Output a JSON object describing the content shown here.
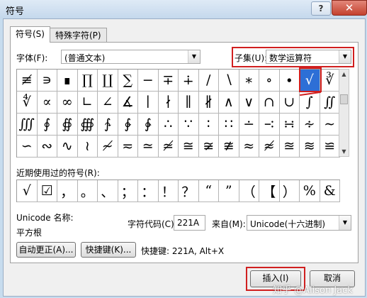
{
  "window": {
    "title": "符号",
    "help": "?",
    "close": "✕"
  },
  "tabs": [
    "符号(S)",
    "特殊字符(P)"
  ],
  "font": {
    "label": "字体(F):",
    "value": "(普通文本)"
  },
  "subset": {
    "label": "子集(U):",
    "value": "数学运算符"
  },
  "symbols": [
    "≢",
    "∍",
    "∎",
    "∏",
    "∐",
    "∑",
    "−",
    "∓",
    "∔",
    "∕",
    "∖",
    "∗",
    "∘",
    "∙",
    "√",
    "∛",
    "∜",
    "∝",
    "∞",
    "∟",
    "∠",
    "∡",
    "∣",
    "∤",
    "∥",
    "∦",
    "∧",
    "∨",
    "∩",
    "∪",
    "∫",
    "∬",
    "∭",
    "∮",
    "∯",
    "∰",
    "∱",
    "∲",
    "∳",
    "∴",
    "∵",
    "∶",
    "∷",
    "∸",
    "∹",
    "∺",
    "∻",
    "∼",
    "∽",
    "∾",
    "∿",
    "≀",
    "≁",
    "≂",
    "≃",
    "≄",
    "≅",
    "≆",
    "≇",
    "≈",
    "≉",
    "≊",
    "≋",
    "≌"
  ],
  "selected_index": 14,
  "recent": {
    "label": "近期使用过的符号(R):",
    "items": [
      "√",
      "☑",
      "，",
      "。",
      "、",
      "；",
      "：",
      "！",
      "？",
      "“",
      "”",
      "（",
      "【",
      "）",
      "%",
      "&"
    ]
  },
  "unicode": {
    "name_label": "Unicode 名称:",
    "name_value": "平方根"
  },
  "code": {
    "label": "字符代码(C):",
    "value": "221A"
  },
  "from": {
    "label": "来自(M):",
    "value": "Unicode(十六进制)"
  },
  "buttons": {
    "autocorrect": "自动更正(A)...",
    "shortcut": "快捷键(K)...",
    "shortcut_text": "快捷键: 221A, Alt+X",
    "insert": "插入(I)",
    "cancel": "取消"
  },
  "watermark": "知乎 @Alison Jack",
  "highlight_color": "#d01f1f"
}
